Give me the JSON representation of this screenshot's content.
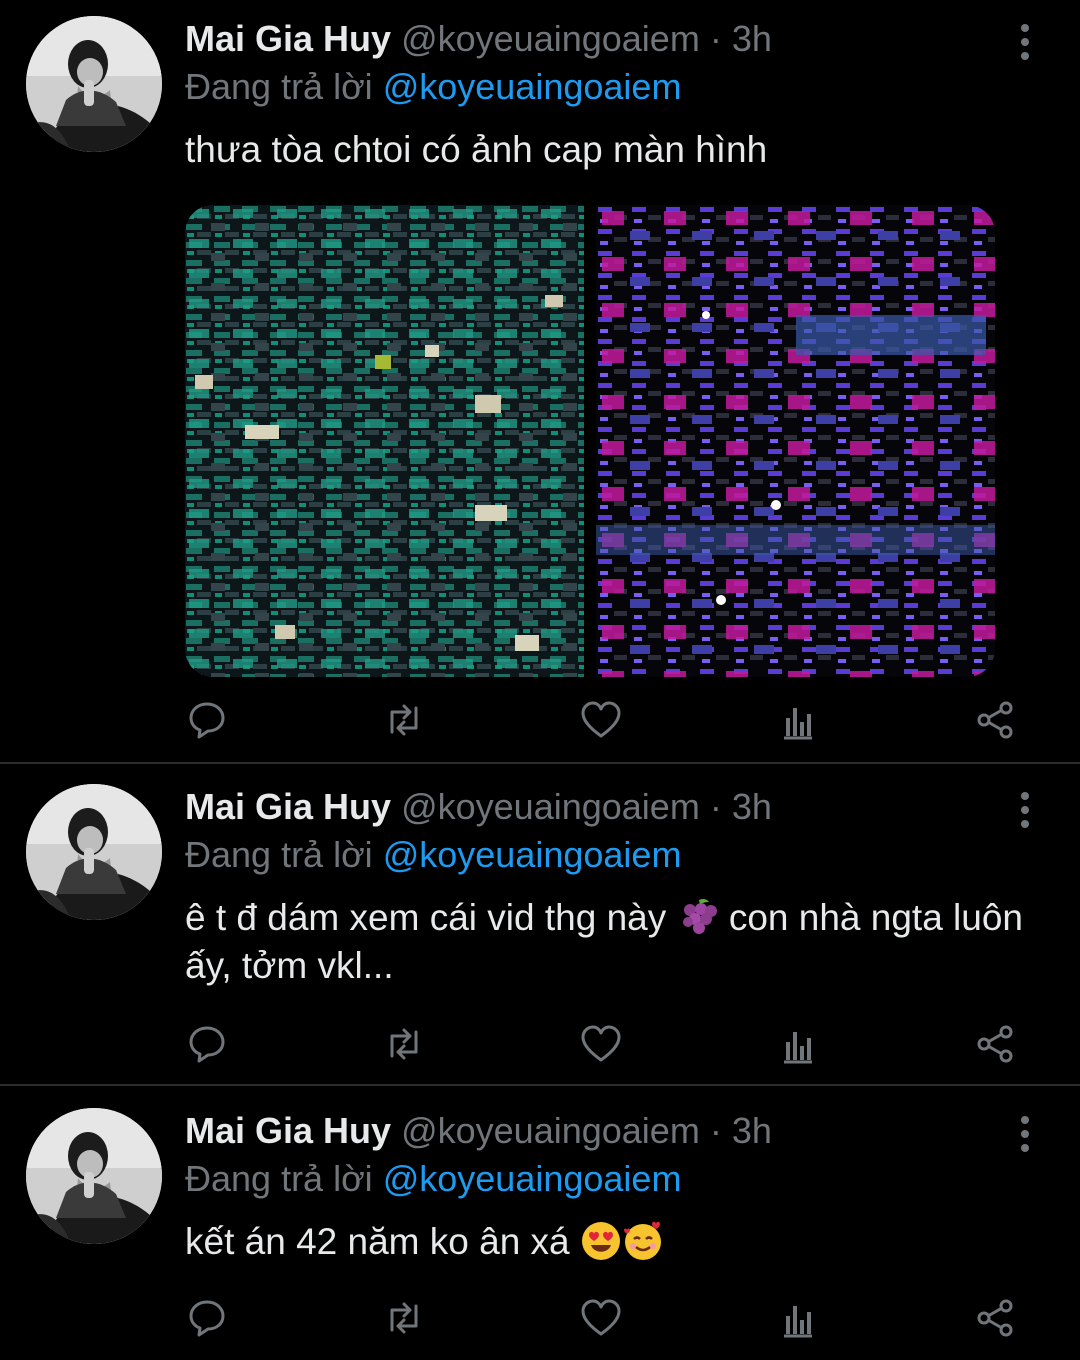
{
  "tweets": [
    {
      "name": "Mai Gia Huy",
      "handle": "@koyeuaingoaiem",
      "dot": "·",
      "time": "3h",
      "reply_prefix": "Đang trả lời",
      "reply_target": "@koyeuaingoaiem",
      "text": "thưa tòa chtoi có ảnh cap màn hình",
      "has_media": true
    },
    {
      "name": "Mai Gia Huy",
      "handle": "@koyeuaingoaiem",
      "dot": "·",
      "time": "3h",
      "reply_prefix": "Đang trả lời",
      "reply_target": "@koyeuaingoaiem",
      "text_before_emoji": "ê t đ dám xem cái vid thg này",
      "emoji_1": "grapes-emoji",
      "text_after_emoji": "con nhà ngta luôn ấy, tởm vkl...",
      "has_media": false
    },
    {
      "name": "Mai Gia Huy",
      "handle": "@koyeuaingoaiem",
      "dot": "·",
      "time": "3h",
      "reply_prefix": "Đang trả lời",
      "reply_target": "@koyeuaingoaiem",
      "text": "kết án 42 năm ko ân xá",
      "emojis": [
        "heart-eyes-emoji",
        "smiling-face-with-hearts-emoji"
      ],
      "has_media": false
    }
  ],
  "icons": [
    "reply-icon",
    "retweet-icon",
    "like-icon",
    "analytics-icon",
    "share-icon",
    "more-options-icon"
  ],
  "colors": {
    "background": "#000000",
    "text": "#e7e9ea",
    "secondary": "#71767b",
    "link": "#1d9bf0",
    "divider": "#2a2d30"
  }
}
